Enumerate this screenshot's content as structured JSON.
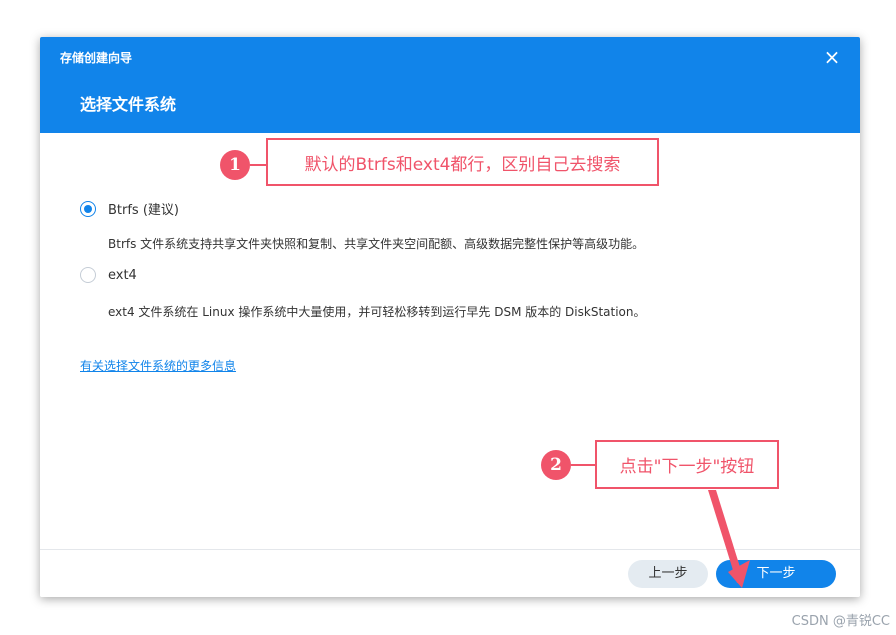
{
  "dialog": {
    "window_title": "存储创建向导",
    "close_icon": "close-icon",
    "page_title": "选择文件系统"
  },
  "options": [
    {
      "label": "Btrfs (建议)",
      "checked": true,
      "description": "Btrfs 文件系统支持共享文件夹快照和复制、共享文件夹空间配额、高级数据完整性保护等高级功能。"
    },
    {
      "label": "ext4",
      "checked": false,
      "description": "ext4 文件系统在 Linux 操作系统中大量使用，并可轻松移转到运行早先 DSM 版本的 DiskStation。"
    }
  ],
  "more_info_link": "有关选择文件系统的更多信息",
  "footer": {
    "prev_label": "上一步",
    "next_label": "下一步"
  },
  "annotations": {
    "callout1_number": "1",
    "callout1_text": "默认的Btrfs和ext4都行，区别自己去搜索",
    "callout2_number": "2",
    "callout2_text": "点击\"下一步\"按钮"
  },
  "watermark": "CSDN @青锐CC",
  "colors": {
    "accent": "#1184ea",
    "annotation": "#f0546a"
  }
}
